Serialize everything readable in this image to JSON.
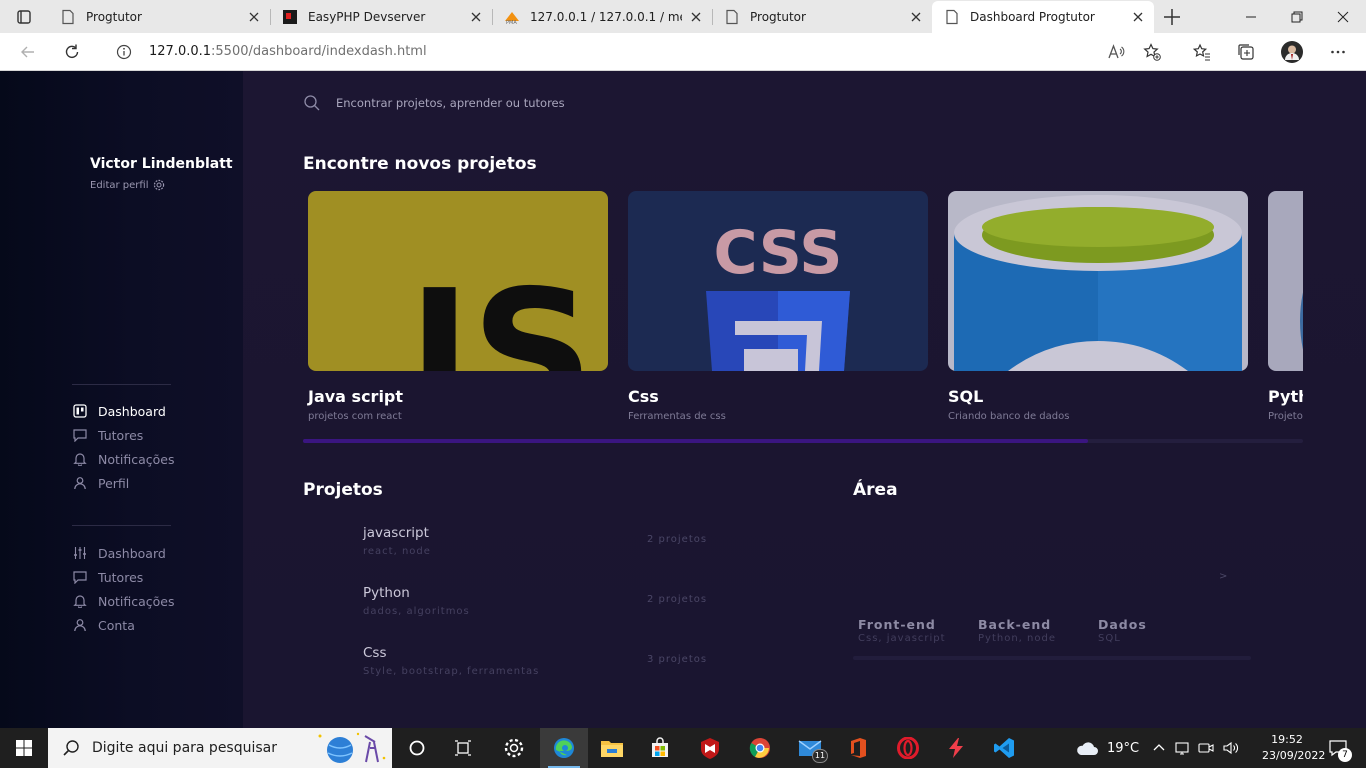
{
  "browser": {
    "tabs": [
      {
        "label": "Progtutor",
        "active": false
      },
      {
        "label": "EasyPHP Devserver",
        "active": false
      },
      {
        "label": "127.0.0.1 / 127.0.0.1 / meusite",
        "active": false
      },
      {
        "label": "Progtutor",
        "active": false
      },
      {
        "label": "Dashboard Progtutor",
        "active": true
      }
    ],
    "url_host": "127.0.0.1",
    "url_rest": ":5500/dashboard/indexdash.html"
  },
  "search": {
    "placeholder": "Encontrar projetos, aprender ou tutores"
  },
  "profile": {
    "name": "Victor Lindenblatt",
    "edit_label": "Editar perfil"
  },
  "nav_primary": [
    {
      "label": "Dashboard",
      "icon": "dashboard-icon",
      "active": true
    },
    {
      "label": "Tutores",
      "icon": "chat-icon",
      "active": false
    },
    {
      "label": "Notificações",
      "icon": "bell-icon",
      "active": false
    },
    {
      "label": "Perfil",
      "icon": "user-icon",
      "active": false
    }
  ],
  "nav_secondary": [
    {
      "label": "Dashboard",
      "icon": "sliders-icon"
    },
    {
      "label": "Tutores",
      "icon": "chat-icon"
    },
    {
      "label": "Notificações",
      "icon": "bell-icon"
    },
    {
      "label": "Conta",
      "icon": "user-icon"
    }
  ],
  "discover": {
    "title": "Encontre novos projetos",
    "cards": [
      {
        "title": "Java script",
        "subtitle": "projetos com react"
      },
      {
        "title": "Css",
        "subtitle": "Ferramentas de css"
      },
      {
        "title": "SQL",
        "subtitle": "Criando banco de dados"
      },
      {
        "title": "Python",
        "subtitle": "Projetos"
      }
    ],
    "js_logo_text": "JS",
    "css_logo_text": "CSS"
  },
  "projects": {
    "title": "Projetos",
    "items": [
      {
        "name": "javascript",
        "tags": "react, node",
        "count": "2 projetos"
      },
      {
        "name": "Python",
        "tags": "dados, algoritmos",
        "count": "2 projetos"
      },
      {
        "name": "Css",
        "tags": "Style, bootstrap, ferramentas",
        "count": "3 projetos"
      }
    ]
  },
  "area": {
    "title": "Área",
    "arrow": ">",
    "categories": [
      {
        "name": "Front-end",
        "tags": "Css, javascript"
      },
      {
        "name": "Back-end",
        "tags": "Python, node"
      },
      {
        "name": "Dados",
        "tags": "SQL"
      }
    ]
  },
  "taskbar": {
    "search_placeholder": "Digite aqui para pesquisar",
    "temperature": "19°C",
    "time": "19:52",
    "date": "23/09/2022",
    "mail_badge": "11",
    "notification_badge": "7"
  },
  "colors": {
    "accent": "#3a1580",
    "page_bg": "#1c1631",
    "sidebar_bg": "#0c0d24",
    "js_yellow": "#a08f23",
    "css_navy": "#1c2a52",
    "sql_blue": "#1d6ab4"
  }
}
